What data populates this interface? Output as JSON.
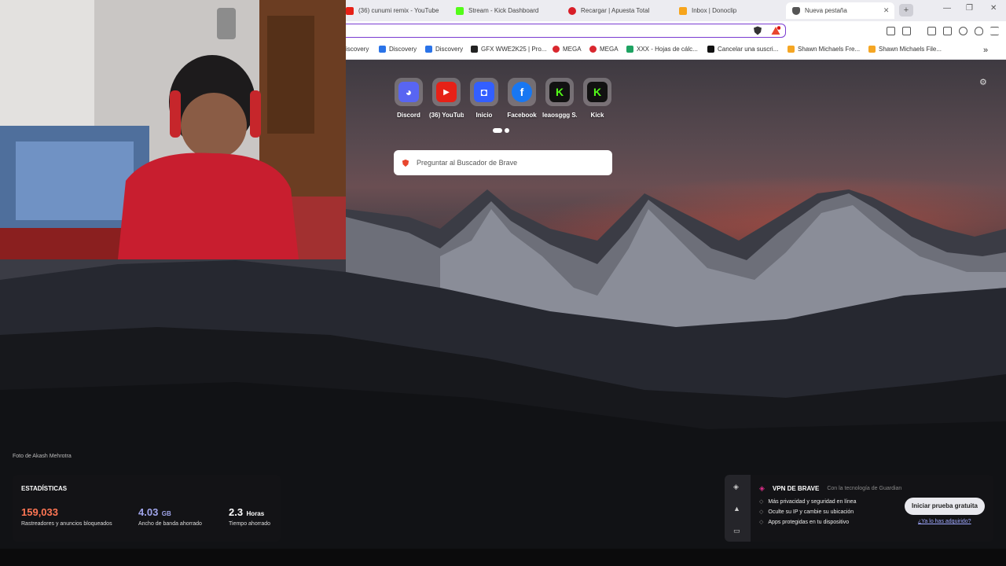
{
  "browser": {
    "tabs": [
      {
        "label": "(36) cunumi remix - YouTube",
        "color": "#e62117"
      },
      {
        "label": "Stream - Kick Dashboard",
        "color": "#53fc18"
      },
      {
        "label": "Recargar | Apuesta Total",
        "color": "#d81e28"
      },
      {
        "label": "Inbox | Donoclip",
        "color": "#f7a51c"
      },
      {
        "label": "Nueva pestaña",
        "color": "#555555"
      }
    ],
    "close_tab_glyph": "✕",
    "new_tab_glyph": "+",
    "window_controls": {
      "minimize": "—",
      "restore": "❐",
      "close": "✕"
    },
    "address_value": ""
  },
  "bookmarks": [
    {
      "label": "iscovery",
      "color": "#2a73e8"
    },
    {
      "label": "Discovery",
      "color": "#2a73e8"
    },
    {
      "label": "Discovery",
      "color": "#2a73e8"
    },
    {
      "label": "GFX WWE2K25 | Pro...",
      "color": "#222222"
    },
    {
      "label": "MEGA",
      "color": "#d9272e"
    },
    {
      "label": "MEGA",
      "color": "#d9272e"
    },
    {
      "label": "XXX - Hojas de cálc...",
      "color": "#1ea362"
    },
    {
      "label": "Cancelar una suscri...",
      "color": "#111111"
    },
    {
      "label": "Shawn Michaels Fre...",
      "color": "#f5a623"
    },
    {
      "label": "Shawn Michaels File...",
      "color": "#f5a623"
    }
  ],
  "bookmarks_overflow": "»",
  "shortcuts": [
    {
      "label": "Discord",
      "glyph": "◕",
      "color": "#5865f2"
    },
    {
      "label": "(36) YouTube",
      "glyph": "▶",
      "color": "#e62117"
    },
    {
      "label": "Inicio",
      "glyph": "◘",
      "color": "#335fff"
    },
    {
      "label": "Facebook",
      "glyph": "f",
      "color": "#1877f2"
    },
    {
      "label": "leaosggg S...",
      "glyph": "K",
      "color": "#53fc18"
    },
    {
      "label": "Kick",
      "glyph": "K",
      "color": "#53fc18"
    }
  ],
  "search": {
    "placeholder": "Preguntar al Buscador de Brave"
  },
  "photo_credit": "Foto de Akash Mehrotra",
  "stats": {
    "title": "ESTADÍSTICAS",
    "trackers": {
      "value": "159,033",
      "desc": "Rastreadores y anuncios bloqueados",
      "color": "#ff7654"
    },
    "bandwidth": {
      "value": "4.03",
      "unit": "GB",
      "desc": "Ancho de banda ahorrado",
      "color": "#a0a5eb"
    },
    "time": {
      "value": "2.3",
      "unit": "Horas",
      "desc": "Tiempo ahorrado",
      "color": "#ffffff"
    }
  },
  "vpn": {
    "title": "VPN DE BRAVE",
    "powered": "Con la tecnología de Guardian",
    "features": [
      "Más privacidad y seguridad en línea",
      "Oculte su IP y cambie su ubicación",
      "Apps protegidas en tu dispositivo"
    ],
    "cta": "Iniciar prueba gratuita",
    "link": "¿Ya lo has adquirido?"
  },
  "settings_glyph": "⚙"
}
